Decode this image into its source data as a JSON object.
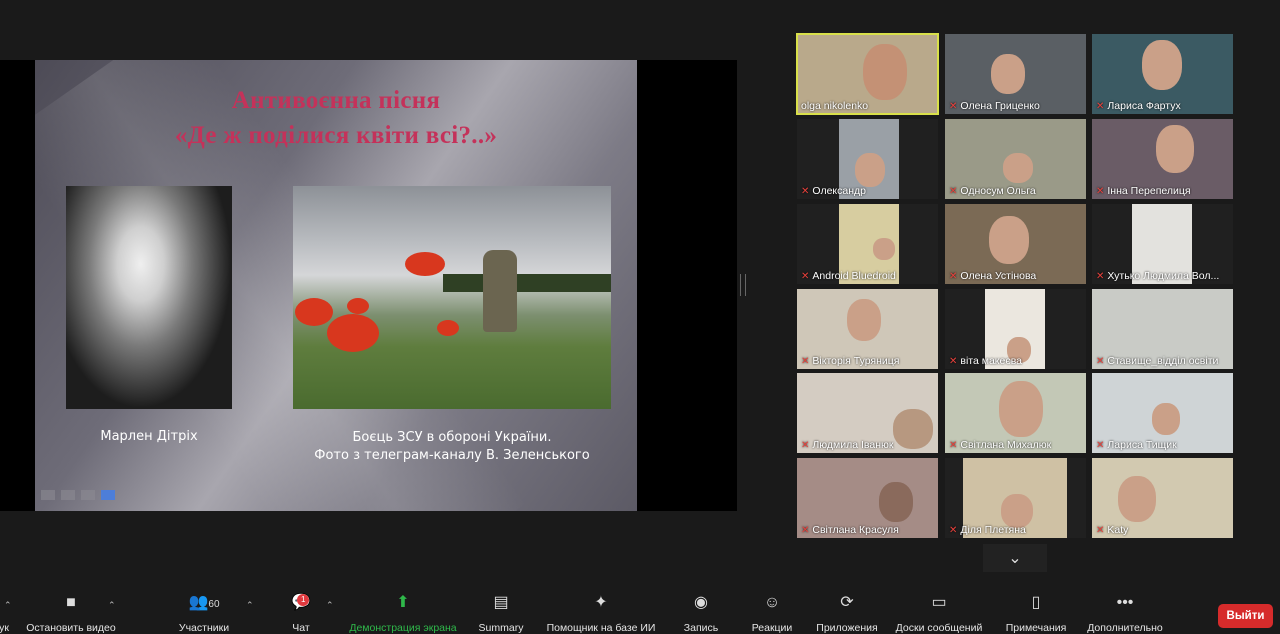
{
  "slide": {
    "title_line1": "Антивоєнна пісня",
    "title_line2": "«Де ж поділися квіти всі?..»",
    "left_caption": "Марлен Дітріх",
    "right_caption_line1": "Боєць ЗСУ в обороні України.",
    "right_caption_line2": "Фото з телеграм-каналу В. Зеленського"
  },
  "participants": [
    {
      "name": "olga nikolenko",
      "muted": false,
      "active": true
    },
    {
      "name": "Олена Гриценко",
      "muted": true
    },
    {
      "name": "Лариса Фартух",
      "muted": true
    },
    {
      "name": "Олександр",
      "muted": true
    },
    {
      "name": "Односум Ольга",
      "muted": true
    },
    {
      "name": "Інна Перепелиця",
      "muted": true
    },
    {
      "name": "Android Bluedroid",
      "muted": true
    },
    {
      "name": "Олена Устінова",
      "muted": true
    },
    {
      "name": "Хутько Людмила Вол...",
      "muted": true
    },
    {
      "name": "Вікторія Туряниця",
      "muted": true
    },
    {
      "name": "віта макеєва",
      "muted": true
    },
    {
      "name": "Ставище_відділ освіти",
      "muted": true
    },
    {
      "name": "Людмила Іванюк",
      "muted": true
    },
    {
      "name": "Світлана Михалюк",
      "muted": true
    },
    {
      "name": "Лариса Тищик",
      "muted": true
    },
    {
      "name": "Світлана Красуля",
      "muted": true
    },
    {
      "name": "Діля Плетяна",
      "muted": true
    },
    {
      "name": "Katy",
      "muted": true
    }
  ],
  "toolbar": {
    "audio_label": "ук",
    "video_label": "Остановить видео",
    "participants_label": "Участники",
    "participants_count": "60",
    "chat_label": "Чат",
    "chat_badge": "1",
    "share_label": "Демонстрация экрана",
    "summary_label": "Summary",
    "ai_label": "Помощник на базе ИИ",
    "record_label": "Запись",
    "reactions_label": "Реакции",
    "apps_label": "Приложения",
    "whiteboards_label": "Доски сообщений",
    "notes_label": "Примечания",
    "more_label": "Дополнительно",
    "leave_label": "Выйти"
  },
  "colors": {
    "title_pink": "#c4325a",
    "active_speaker": "#d9e04a",
    "share_green": "#2fb84a",
    "leave_red": "#d62b2b",
    "muted_red": "#e8413c"
  }
}
